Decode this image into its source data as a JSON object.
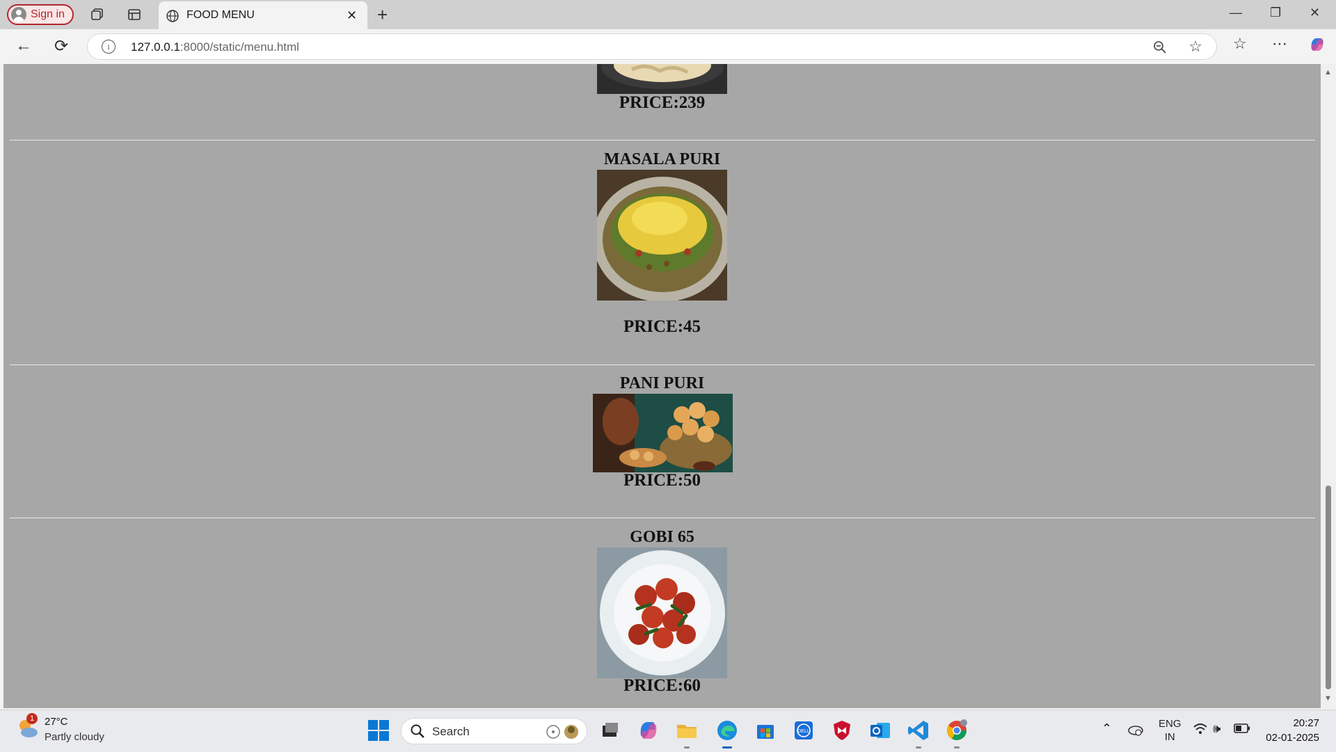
{
  "browser": {
    "sign_in_label": "Sign in",
    "tab_title": "FOOD MENU",
    "url_host": "127.0.0.1",
    "url_rest": ":8000/static/menu.html"
  },
  "menu": {
    "prev_price": "PRICE:239",
    "items": [
      {
        "name": "MASALA PURI",
        "price": "PRICE:45"
      },
      {
        "name": "PANI PURI",
        "price": "PRICE:50"
      },
      {
        "name": "GOBI 65",
        "price": "PRICE:60"
      }
    ]
  },
  "taskbar": {
    "weather_badge": "1",
    "temperature": "27°C",
    "condition": "Partly cloudy",
    "search_label": "Search",
    "lang_top": "ENG",
    "lang_bottom": "IN",
    "time": "20:27",
    "date": "02-01-2025"
  },
  "colors": {
    "page_background": "#a7a7a7",
    "signin_accent": "#b3262d",
    "windows_blue": "#0067c0"
  }
}
